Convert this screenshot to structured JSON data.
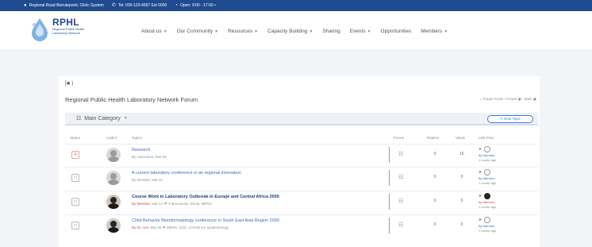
{
  "topbar": {
    "address_icon": "home-icon",
    "address": "Regional Road Beirutepoint, Clinic System",
    "phone_icon": "phone-icon",
    "phone": "Tel: 000-123-4567 Ext 0000",
    "hours_icon": "clock-icon",
    "hours": "Open: 9:00 - 17:00 •"
  },
  "logo": {
    "title": "RPHL",
    "subtitle": "Regional Public Health Laboratory Network",
    "icon": "water-drop-logo-icon"
  },
  "nav": [
    {
      "label": "About us"
    },
    {
      "label": "Our Community"
    },
    {
      "label": "Resources"
    },
    {
      "label": "Capacity Building"
    },
    {
      "label": "Sharing"
    },
    {
      "label": "Events"
    },
    {
      "label": "Opportunities"
    },
    {
      "label": "Members"
    }
  ],
  "forum": {
    "top_crumb": "[■ )",
    "title": "Regional Public Health Laboratory Network Forum",
    "breadcrumb": "⌂ Forum Posts › Forum ▣ › Main ▣",
    "category": "Main Category",
    "new_topic": "✎ New Topic",
    "headers": {
      "status": "Status",
      "author": "Author",
      "topics": "Topics",
      "forum": "Forum",
      "replies": "Replies",
      "views": "Views",
      "last_post": "Last Post"
    }
  },
  "rows": [
    {
      "status": "✕",
      "title": "Research",
      "meta": "By Username, Mar 00",
      "replies": "0",
      "views": "16",
      "last_name": "By Member",
      "last_time": "1 month ago"
    },
    {
      "status": "□",
      "title": "A current laboratory conference in an regional innovation",
      "meta": "By Member, Mar 11",
      "replies": "0",
      "views": "0",
      "last_name": "By Member",
      "last_time": "1 month ago"
    },
    {
      "status": "□",
      "title": "Course Work in Laboratory Outbreak in Europe and Central Africa 2000",
      "meta_red": "By Member",
      "meta": ", Mar 12 ⚑ Tuberculosis, Ebola, MERS",
      "replies": "0",
      "views": "0",
      "last_name": "By Member",
      "last_time": "1 month ago"
    },
    {
      "status": "□",
      "title": "Child Behavior Bioinformatology conference in South East Asia Region 2000",
      "meta_red": "By Dr. Lee",
      "meta": ", Mar 08 ⚑ MERS, SDG, COVID-19, Epidemiology",
      "replies": "0",
      "views": "0",
      "last_name": "By Member",
      "last_time": "1 month ago"
    }
  ]
}
